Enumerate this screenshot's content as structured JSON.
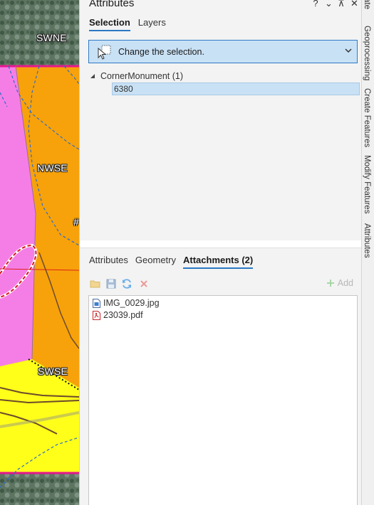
{
  "map": {
    "labels": {
      "swne": "SWNE",
      "nwse": "NWSE",
      "swse": "SWSE",
      "hash": "#"
    }
  },
  "pane": {
    "title": "Attributes",
    "controls": {
      "help": "?",
      "menu": "⌄",
      "pin": "⊼",
      "close": "✕"
    },
    "tabs": [
      {
        "label": "Selection",
        "active": true
      },
      {
        "label": "Layers",
        "active": false
      }
    ],
    "selection_bar": {
      "text": "Change the selection.",
      "icon": "select-cursor-icon"
    },
    "tree": {
      "layer_label": "CornerMonument (1)",
      "feature_id": "6380"
    },
    "detail_tabs": [
      {
        "label": "Attributes",
        "active": false
      },
      {
        "label": "Geometry",
        "active": false
      },
      {
        "label": "Attachments (2)",
        "active": true
      }
    ],
    "toolbar": {
      "add_label": "Add"
    },
    "attachments": [
      {
        "name": "IMG_0029.jpg",
        "icon": "image-file-icon"
      },
      {
        "name": "23039.pdf",
        "icon": "pdf-file-icon"
      }
    ]
  },
  "dock": {
    "tabs": [
      "ate",
      "Geoprocessing",
      "Create Features",
      "Modify Features",
      "Attributes"
    ]
  },
  "colors": {
    "accent": "#2b78c4",
    "selection_fill": "#c9e1f5",
    "parcel_pink": "#f57ee6",
    "parcel_orange": "#f7a20a",
    "parcel_yellow": "#ffff1a",
    "boundary_magenta": "#e6178c"
  }
}
